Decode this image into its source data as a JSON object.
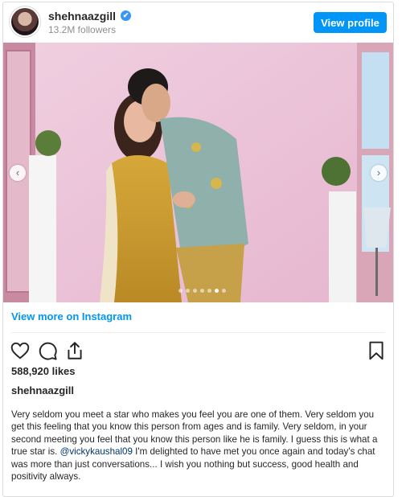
{
  "header": {
    "username": "shehnaazgill",
    "verified_mark": "✔",
    "followers": "13.2M followers",
    "view_profile_label": "View profile"
  },
  "photo": {
    "dots_count": 7,
    "active_dot_index": 5,
    "prev_glyph": "‹",
    "next_glyph": "›"
  },
  "links": {
    "view_more": "View more on Instagram"
  },
  "stats": {
    "likes": "588,920 likes"
  },
  "post": {
    "owner": "shehnaazgill",
    "caption_part1": "Very seldom you meet a star who makes you feel you are one of them. Very seldom you get this feeling that you know this person from ages and is family. Very seldom, in your second meeting you feel that you know this person like he is family. I guess this is what a true star is. ",
    "mention": "@vickykaushal09",
    "caption_part2": " I'm delighted to have met you once again and today's chat was more than just conversations... I wish you nothing but success, good health and positivity always."
  },
  "icons": {
    "like": "heart-icon",
    "comment": "comment-icon",
    "share": "share-icon",
    "save": "bookmark-icon",
    "verified": "verified-badge-icon"
  },
  "colors": {
    "accent": "#0095f6",
    "background_wall": "#e8bfd6"
  }
}
